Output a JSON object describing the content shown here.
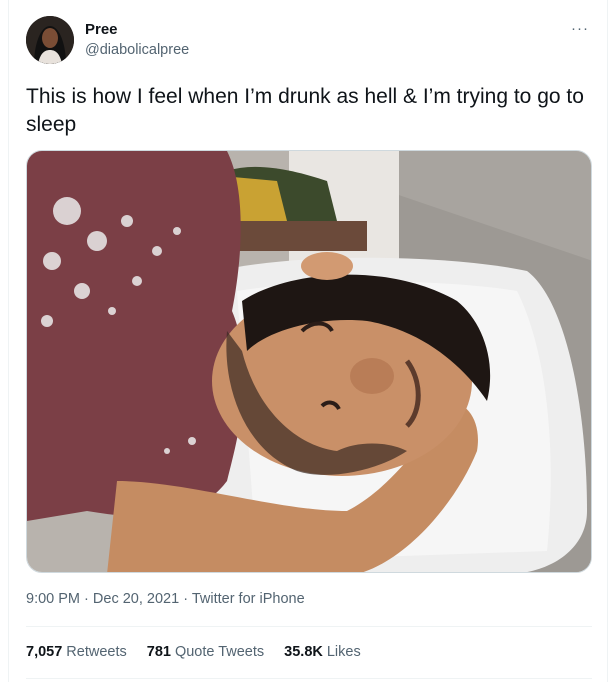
{
  "author": {
    "name": "Pree",
    "handle": "@diabolicalpree",
    "avatar_icon": "profile-photo-avatar"
  },
  "more_icon": "···",
  "tweet": {
    "text": "This is how I feel when I’m drunk as hell & I’m trying to go to sleep"
  },
  "media": {
    "icon": "photo-sleeping-man"
  },
  "meta": {
    "time": "9:00 PM",
    "sep1": "·",
    "date": "Dec 20, 2021",
    "sep2": "·",
    "source": "Twitter for iPhone"
  },
  "stats": {
    "retweets_count": "7,057",
    "retweets_label": "Retweets",
    "quotes_count": "781",
    "quotes_label": "Quote Tweets",
    "likes_count": "35.8K",
    "likes_label": "Likes"
  },
  "colors": {
    "text_primary": "#0f1419",
    "text_secondary": "#536471",
    "border": "#cfd9de"
  }
}
